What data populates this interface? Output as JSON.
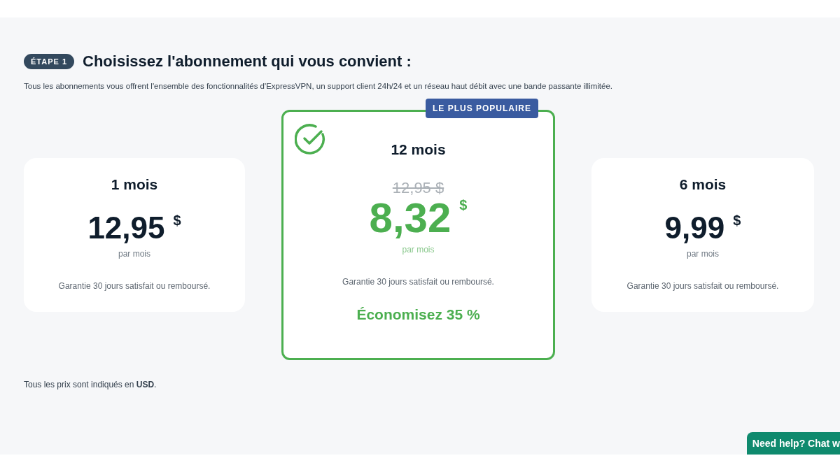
{
  "step": {
    "badge": "ÉTAPE 1",
    "title": "Choisissez l'abonnement qui vous convient :"
  },
  "description": "Tous les abonnements vous offrent l'ensemble des fonctionnalités d'ExpressVPN, un support client 24h/24 et un réseau haut débit avec une bande passante illimitée.",
  "plans": [
    {
      "duration": "1 mois",
      "price": "12,95",
      "currency": "$",
      "period": "par mois",
      "guarantee": "Garantie 30 jours satisfait ou remboursé.",
      "selected": false
    },
    {
      "duration": "12 mois",
      "badge": "LE PLUS POPULAIRE",
      "old_price": "12,95 $",
      "price": "8,32",
      "currency": "$",
      "period": "par mois",
      "guarantee": "Garantie 30 jours satisfait ou remboursé.",
      "savings": "Économisez 35 %",
      "selected": true
    },
    {
      "duration": "6 mois",
      "price": "9,99",
      "currency": "$",
      "period": "par mois",
      "guarantee": "Garantie 30 jours satisfait ou remboursé.",
      "selected": false
    }
  ],
  "footnote": "Tous les prix sont indiqués en **USD**.",
  "chat_button": "Need help? Chat w"
}
